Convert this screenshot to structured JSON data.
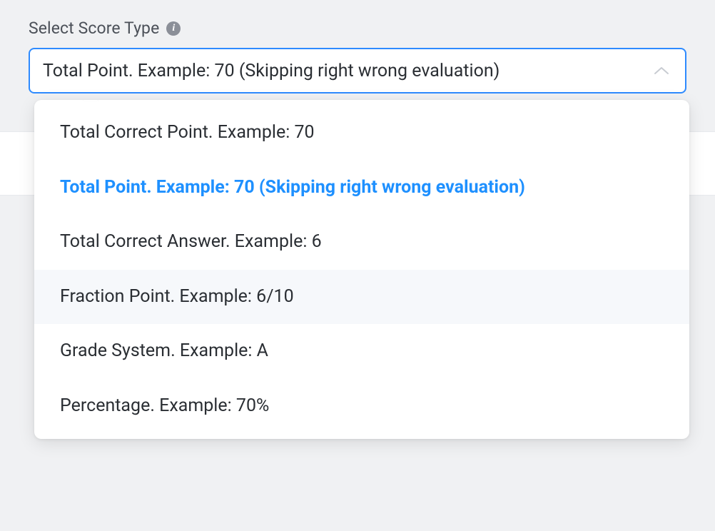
{
  "field": {
    "label": "Select Score Type"
  },
  "select": {
    "value": "Total Point. Example: 70 (Skipping right wrong evaluation)"
  },
  "options": [
    {
      "label": "Total Correct Point. Example: 70",
      "selected": false,
      "hovered": false
    },
    {
      "label": "Total Point. Example: 70 (Skipping right wrong evaluation)",
      "selected": true,
      "hovered": false
    },
    {
      "label": "Total Correct Answer. Example: 6",
      "selected": false,
      "hovered": false
    },
    {
      "label": "Fraction Point. Example: 6/10",
      "selected": false,
      "hovered": true
    },
    {
      "label": "Grade System. Example: A",
      "selected": false,
      "hovered": false
    },
    {
      "label": "Percentage. Example: 70%",
      "selected": false,
      "hovered": false
    }
  ]
}
